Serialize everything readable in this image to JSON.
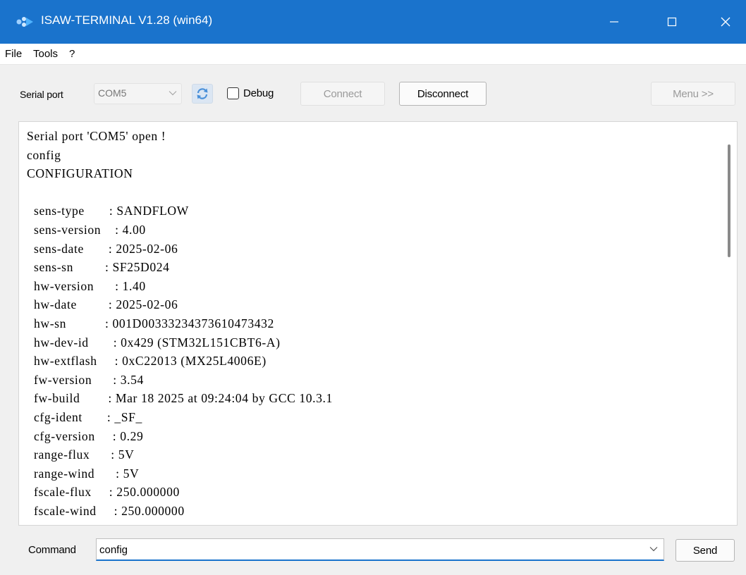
{
  "window": {
    "title": "ISAW-TERMINAL V1.28 (win64)",
    "titlebar_color": "#1a73cc",
    "controls": [
      "minimize-icon",
      "maximize-icon",
      "close-icon"
    ]
  },
  "menu": [
    "File",
    "Tools",
    "?"
  ],
  "toolbar": {
    "serial_port_label": "Serial port",
    "port_value": "COM5",
    "refresh_icon": "refresh-icon",
    "debug_label": "Debug",
    "debug_checked": false,
    "connect_label": "Connect",
    "disconnect_label": "Disconnect",
    "menu_label": "Menu >>"
  },
  "console": {
    "lines": [
      "Serial port 'COM5' open !",
      "config",
      "CONFIGURATION",
      "",
      "  sens-type       : SANDFLOW",
      "  sens-version    : 4.00",
      "  sens-date       : 2025-02-06",
      "  sens-sn         : SF25D024",
      "  hw-version      : 1.40",
      "  hw-date         : 2025-02-06",
      "  hw-sn           : 001D00333234373610473432",
      "  hw-dev-id       : 0x429 (STM32L151CBT6-A)",
      "  hw-extflash     : 0xC22013 (MX25L4006E)",
      "  fw-version      : 3.54",
      "  fw-build        : Mar 18 2025 at 09:24:04 by GCC 10.3.1",
      "  cfg-ident       : _SF_",
      "  cfg-version     : 0.29",
      "  range-flux      : 5V",
      "  range-wind      : 5V",
      "  fscale-flux     : 250.000000",
      "  fscale-wind     : 250.000000"
    ]
  },
  "command": {
    "label": "Command",
    "value": "config",
    "send_label": "Send"
  },
  "colors": {
    "accent": "#1a73cc",
    "background": "#f0f0f0",
    "disabled_text": "#9a9a9a"
  }
}
